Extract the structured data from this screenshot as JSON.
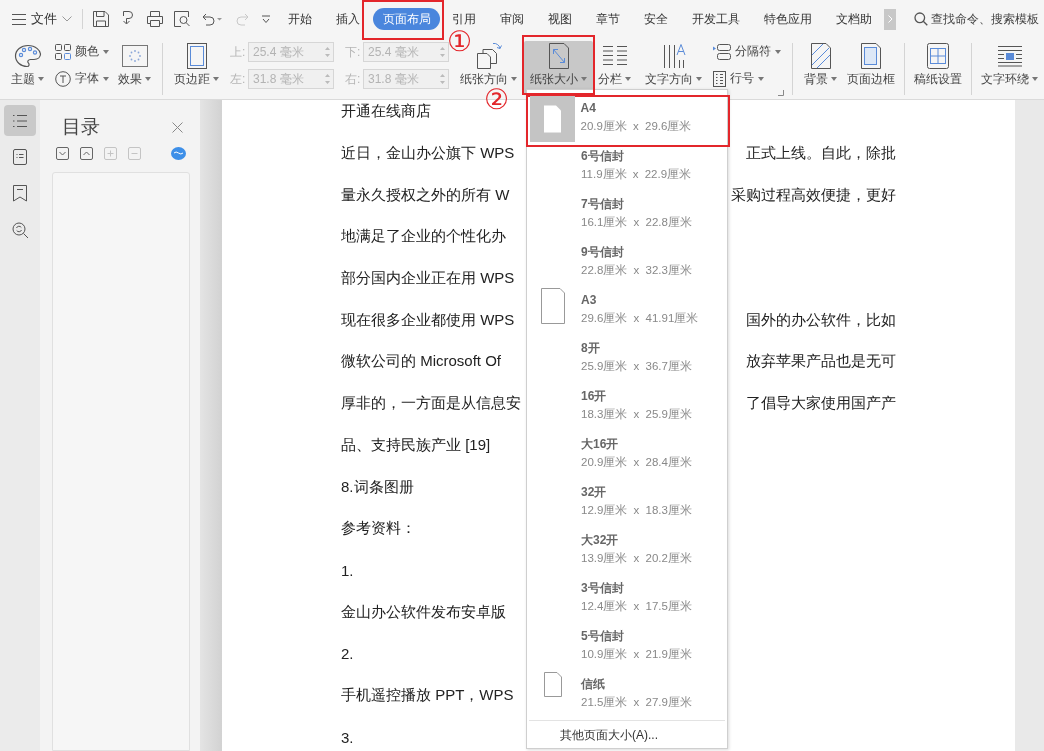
{
  "menu_bar": {
    "file_menu": {
      "label": "文件"
    },
    "quick_access": [
      {
        "kind": "save",
        "disabled": false
      },
      {
        "kind": "export",
        "disabled": false
      },
      {
        "kind": "print",
        "disabled": false
      },
      {
        "kind": "preview",
        "disabled": false
      },
      {
        "kind": "undo",
        "disabled": false
      },
      {
        "kind": "redo",
        "disabled": true
      },
      {
        "kind": "customize",
        "disabled": false
      }
    ],
    "tabs": [
      {
        "label": "开始",
        "selected": false,
        "highlighted": false
      },
      {
        "label": "插入",
        "selected": false,
        "highlighted": false
      },
      {
        "label": "页面布局",
        "selected": true,
        "highlighted": true
      },
      {
        "label": "引用",
        "selected": false,
        "highlighted": false
      },
      {
        "label": "审阅",
        "selected": false,
        "highlighted": false
      },
      {
        "label": "视图",
        "selected": false,
        "highlighted": false
      },
      {
        "label": "章节",
        "selected": false,
        "highlighted": false
      },
      {
        "label": "安全",
        "selected": false,
        "highlighted": false
      },
      {
        "label": "开发工具",
        "selected": false,
        "highlighted": false
      },
      {
        "label": "特色应用",
        "selected": false,
        "highlighted": false
      },
      {
        "label": "文档助",
        "selected": false,
        "highlighted": false
      }
    ],
    "search": {
      "placeholder": "查找命令、搜索模板"
    }
  },
  "ribbon": {
    "theme": {
      "label": "主题",
      "has_menu": true
    },
    "colors": {
      "label": "颜色",
      "has_menu": true
    },
    "fonts": {
      "label": "字体",
      "has_menu": true
    },
    "effects": {
      "label": "效果",
      "has_menu": true
    },
    "margins": {
      "label": "页边距",
      "has_menu": true
    },
    "margin_fields": [
      {
        "label": "上:",
        "value": "25.4 毫米",
        "disabled": true
      },
      {
        "label": "下:",
        "value": "25.4 毫米",
        "disabled": true
      },
      {
        "label": "左:",
        "value": "31.8 毫米",
        "disabled": true
      },
      {
        "label": "右:",
        "value": "31.8 毫米",
        "disabled": true
      }
    ],
    "orientation": {
      "label": "纸张方向",
      "has_menu": true
    },
    "paper_size": {
      "label": "纸张大小",
      "has_menu": true,
      "pressed": true,
      "highlighted": true
    },
    "columns": {
      "label": "分栏",
      "has_menu": true
    },
    "text_direction": {
      "label": "文字方向",
      "has_menu": true
    },
    "breaks": {
      "label": "分隔符",
      "has_menu": true
    },
    "line_numbers": {
      "label": "行号",
      "has_menu": true
    },
    "background": {
      "label": "背景",
      "has_menu": true
    },
    "page_border": {
      "label": "页面边框",
      "has_menu": false
    },
    "manuscript": {
      "label": "稿纸设置",
      "has_menu": false
    },
    "text_wrap": {
      "label": "文字环绕",
      "has_menu": true
    }
  },
  "nav_rail": [
    {
      "selected": true
    },
    {
      "selected": false
    },
    {
      "selected": false
    },
    {
      "selected": false
    }
  ],
  "toc_panel": {
    "title": "目录",
    "tools": [
      {
        "disabled": false
      },
      {
        "disabled": false
      },
      {
        "disabled": true
      },
      {
        "disabled": true
      }
    ]
  },
  "document": {
    "lines": [
      {
        "text": "开通在线商店"
      },
      {
        "text": "近日，金山办公旗下 WPS",
        "tail": "正式上线。自此，除批"
      },
      {
        "text": "量永久授权之外的所有 W",
        "tail": "采购过程高效便捷，更好"
      },
      {
        "text": "地满足了企业的个性化办"
      },
      {
        "text": "部分国内企业正在用 WPS"
      },
      {
        "text": "现在很多企业都使用 WPS",
        "tail": "国外的办公软件，比如"
      },
      {
        "text": "微软公司的 Microsoft Of",
        "tail": "放弃苹果产品也是无可"
      },
      {
        "text": "厚非的，一方面是从信息安",
        "tail": "了倡导大家使用国产产"
      },
      {
        "text": "品、支持民族产业 [19]"
      },
      {
        "text": "8.词条图册"
      },
      {
        "text": "参考资料："
      },
      {
        "text": "1."
      },
      {
        "text": "金山办公软件发布安卓版"
      },
      {
        "text": "2."
      },
      {
        "text": "手机遥控播放 PPT，WPS"
      },
      {
        "text": "3."
      }
    ]
  },
  "paper_menu": {
    "items": [
      {
        "name": "A4",
        "size": "20.9厘米 x 29.6厘米",
        "kind": "page",
        "selected": true,
        "highlighted": true
      },
      {
        "name": "6号信封",
        "size": "11.9厘米 x 22.9厘米",
        "kind": "text",
        "selected": false,
        "highlighted": false
      },
      {
        "name": "7号信封",
        "size": "16.1厘米 x 22.8厘米",
        "kind": "text",
        "selected": false,
        "highlighted": false
      },
      {
        "name": "9号信封",
        "size": "22.8厘米 x 32.3厘米",
        "kind": "text",
        "selected": false,
        "highlighted": false
      },
      {
        "name": "A3",
        "size": "29.6厘米 x 41.91厘米",
        "kind": "page",
        "selected": false,
        "highlighted": false
      },
      {
        "name": "8开",
        "size": "25.9厘米 x 36.7厘米",
        "kind": "text",
        "selected": false,
        "highlighted": false
      },
      {
        "name": "16开",
        "size": "18.3厘米 x 25.9厘米",
        "kind": "text",
        "selected": false,
        "highlighted": false
      },
      {
        "name": "大16开",
        "size": "20.9厘米 x 28.4厘米",
        "kind": "text",
        "selected": false,
        "highlighted": false
      },
      {
        "name": "32开",
        "size": "12.9厘米 x 18.3厘米",
        "kind": "text",
        "selected": false,
        "highlighted": false
      },
      {
        "name": "大32开",
        "size": "13.9厘米 x 20.2厘米",
        "kind": "text",
        "selected": false,
        "highlighted": false
      },
      {
        "name": "3号信封",
        "size": "12.4厘米 x 17.5厘米",
        "kind": "text",
        "selected": false,
        "highlighted": false
      },
      {
        "name": "5号信封",
        "size": "10.9厘米 x 21.9厘米",
        "kind": "text",
        "selected": false,
        "highlighted": false
      },
      {
        "name": "信纸",
        "size": "21.5厘米 x 27.9厘米",
        "kind": "page",
        "selected": false,
        "highlighted": false
      }
    ],
    "footer": "其他页面大小(A)..."
  },
  "callouts": [
    {
      "label": "①"
    },
    {
      "label": "②"
    }
  ]
}
